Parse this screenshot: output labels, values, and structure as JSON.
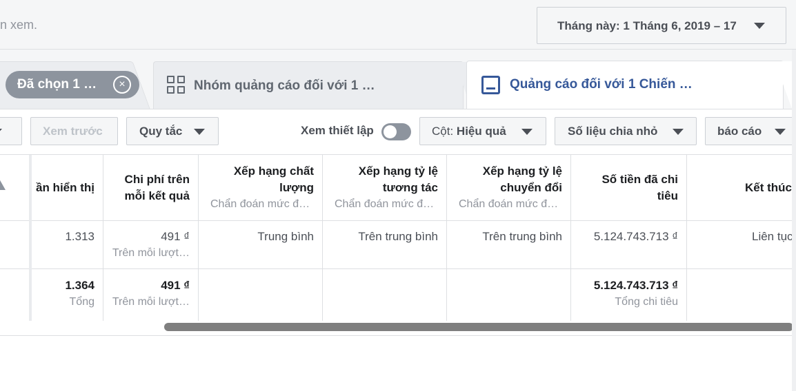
{
  "topbar": {
    "hint_fragment": "n xem.",
    "date_range": "Tháng này: 1 Tháng 6, 2019 – 17"
  },
  "tabs": {
    "selected_chip": "Đã chọn 1 …",
    "adsets": "Nhóm quảng cáo đối với 1 …",
    "ads": "Quảng cáo đối với 1 Chiến …"
  },
  "toolbar": {
    "preview": "Xem trước",
    "rules": "Quy tắc",
    "setup_label": "Xem thiết lập",
    "setup_on": false,
    "columns_prefix": "Cột:",
    "columns_value": "Hiệu quả",
    "breakdown": "Số liệu chia nhỏ",
    "report": "báo cáo"
  },
  "table": {
    "headers": {
      "impressions": "ần hiển thị",
      "cost_per_result": [
        "Chi phí trên",
        "mỗi kết quả"
      ],
      "quality": [
        "Xếp hạng chất",
        "lượng"
      ],
      "engagement": [
        "Xếp hạng tỷ lệ",
        "tương tác"
      ],
      "conversion": [
        "Xếp hạng tỷ lệ",
        "chuyển đổi"
      ],
      "spent": [
        "Số tiền đã chi",
        "tiêu"
      ],
      "end": "Kết thúc",
      "diagnostic_sub": "Chẩn đoán mức độ…"
    },
    "row": {
      "impressions": "1.313",
      "cost": "491 ₫",
      "cost_sub": "Trên mỗi lượt…",
      "quality": "Trung bình",
      "engagement": "Trên trung bình",
      "conversion": "Trên trung bình",
      "spent": "5.124.743.713 ₫",
      "end": "Liên tục"
    },
    "total": {
      "impressions": "1.364",
      "impressions_sub": "Tổng",
      "cost": "491 ₫",
      "cost_sub": "Trên mỗi lượt…",
      "spent": "5.124.743.713 ₫",
      "spent_sub": "Tổng chi tiêu"
    }
  },
  "colors": {
    "accent": "#365899",
    "chip": "#8d949e",
    "border": "#dddfe2"
  }
}
